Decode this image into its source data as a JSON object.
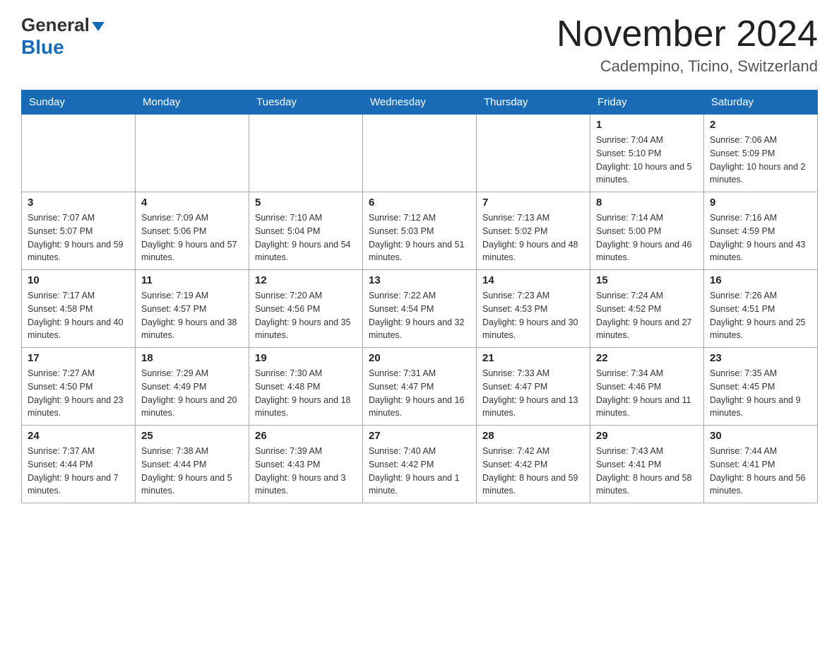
{
  "header": {
    "logo_general": "General",
    "logo_blue": "Blue",
    "month_title": "November 2024",
    "location": "Cadempino, Ticino, Switzerland"
  },
  "weekdays": [
    "Sunday",
    "Monday",
    "Tuesday",
    "Wednesday",
    "Thursday",
    "Friday",
    "Saturday"
  ],
  "weeks": [
    [
      {
        "day": "",
        "sunrise": "",
        "sunset": "",
        "daylight": ""
      },
      {
        "day": "",
        "sunrise": "",
        "sunset": "",
        "daylight": ""
      },
      {
        "day": "",
        "sunrise": "",
        "sunset": "",
        "daylight": ""
      },
      {
        "day": "",
        "sunrise": "",
        "sunset": "",
        "daylight": ""
      },
      {
        "day": "",
        "sunrise": "",
        "sunset": "",
        "daylight": ""
      },
      {
        "day": "1",
        "sunrise": "Sunrise: 7:04 AM",
        "sunset": "Sunset: 5:10 PM",
        "daylight": "Daylight: 10 hours and 5 minutes."
      },
      {
        "day": "2",
        "sunrise": "Sunrise: 7:06 AM",
        "sunset": "Sunset: 5:09 PM",
        "daylight": "Daylight: 10 hours and 2 minutes."
      }
    ],
    [
      {
        "day": "3",
        "sunrise": "Sunrise: 7:07 AM",
        "sunset": "Sunset: 5:07 PM",
        "daylight": "Daylight: 9 hours and 59 minutes."
      },
      {
        "day": "4",
        "sunrise": "Sunrise: 7:09 AM",
        "sunset": "Sunset: 5:06 PM",
        "daylight": "Daylight: 9 hours and 57 minutes."
      },
      {
        "day": "5",
        "sunrise": "Sunrise: 7:10 AM",
        "sunset": "Sunset: 5:04 PM",
        "daylight": "Daylight: 9 hours and 54 minutes."
      },
      {
        "day": "6",
        "sunrise": "Sunrise: 7:12 AM",
        "sunset": "Sunset: 5:03 PM",
        "daylight": "Daylight: 9 hours and 51 minutes."
      },
      {
        "day": "7",
        "sunrise": "Sunrise: 7:13 AM",
        "sunset": "Sunset: 5:02 PM",
        "daylight": "Daylight: 9 hours and 48 minutes."
      },
      {
        "day": "8",
        "sunrise": "Sunrise: 7:14 AM",
        "sunset": "Sunset: 5:00 PM",
        "daylight": "Daylight: 9 hours and 46 minutes."
      },
      {
        "day": "9",
        "sunrise": "Sunrise: 7:16 AM",
        "sunset": "Sunset: 4:59 PM",
        "daylight": "Daylight: 9 hours and 43 minutes."
      }
    ],
    [
      {
        "day": "10",
        "sunrise": "Sunrise: 7:17 AM",
        "sunset": "Sunset: 4:58 PM",
        "daylight": "Daylight: 9 hours and 40 minutes."
      },
      {
        "day": "11",
        "sunrise": "Sunrise: 7:19 AM",
        "sunset": "Sunset: 4:57 PM",
        "daylight": "Daylight: 9 hours and 38 minutes."
      },
      {
        "day": "12",
        "sunrise": "Sunrise: 7:20 AM",
        "sunset": "Sunset: 4:56 PM",
        "daylight": "Daylight: 9 hours and 35 minutes."
      },
      {
        "day": "13",
        "sunrise": "Sunrise: 7:22 AM",
        "sunset": "Sunset: 4:54 PM",
        "daylight": "Daylight: 9 hours and 32 minutes."
      },
      {
        "day": "14",
        "sunrise": "Sunrise: 7:23 AM",
        "sunset": "Sunset: 4:53 PM",
        "daylight": "Daylight: 9 hours and 30 minutes."
      },
      {
        "day": "15",
        "sunrise": "Sunrise: 7:24 AM",
        "sunset": "Sunset: 4:52 PM",
        "daylight": "Daylight: 9 hours and 27 minutes."
      },
      {
        "day": "16",
        "sunrise": "Sunrise: 7:26 AM",
        "sunset": "Sunset: 4:51 PM",
        "daylight": "Daylight: 9 hours and 25 minutes."
      }
    ],
    [
      {
        "day": "17",
        "sunrise": "Sunrise: 7:27 AM",
        "sunset": "Sunset: 4:50 PM",
        "daylight": "Daylight: 9 hours and 23 minutes."
      },
      {
        "day": "18",
        "sunrise": "Sunrise: 7:29 AM",
        "sunset": "Sunset: 4:49 PM",
        "daylight": "Daylight: 9 hours and 20 minutes."
      },
      {
        "day": "19",
        "sunrise": "Sunrise: 7:30 AM",
        "sunset": "Sunset: 4:48 PM",
        "daylight": "Daylight: 9 hours and 18 minutes."
      },
      {
        "day": "20",
        "sunrise": "Sunrise: 7:31 AM",
        "sunset": "Sunset: 4:47 PM",
        "daylight": "Daylight: 9 hours and 16 minutes."
      },
      {
        "day": "21",
        "sunrise": "Sunrise: 7:33 AM",
        "sunset": "Sunset: 4:47 PM",
        "daylight": "Daylight: 9 hours and 13 minutes."
      },
      {
        "day": "22",
        "sunrise": "Sunrise: 7:34 AM",
        "sunset": "Sunset: 4:46 PM",
        "daylight": "Daylight: 9 hours and 11 minutes."
      },
      {
        "day": "23",
        "sunrise": "Sunrise: 7:35 AM",
        "sunset": "Sunset: 4:45 PM",
        "daylight": "Daylight: 9 hours and 9 minutes."
      }
    ],
    [
      {
        "day": "24",
        "sunrise": "Sunrise: 7:37 AM",
        "sunset": "Sunset: 4:44 PM",
        "daylight": "Daylight: 9 hours and 7 minutes."
      },
      {
        "day": "25",
        "sunrise": "Sunrise: 7:38 AM",
        "sunset": "Sunset: 4:44 PM",
        "daylight": "Daylight: 9 hours and 5 minutes."
      },
      {
        "day": "26",
        "sunrise": "Sunrise: 7:39 AM",
        "sunset": "Sunset: 4:43 PM",
        "daylight": "Daylight: 9 hours and 3 minutes."
      },
      {
        "day": "27",
        "sunrise": "Sunrise: 7:40 AM",
        "sunset": "Sunset: 4:42 PM",
        "daylight": "Daylight: 9 hours and 1 minute."
      },
      {
        "day": "28",
        "sunrise": "Sunrise: 7:42 AM",
        "sunset": "Sunset: 4:42 PM",
        "daylight": "Daylight: 8 hours and 59 minutes."
      },
      {
        "day": "29",
        "sunrise": "Sunrise: 7:43 AM",
        "sunset": "Sunset: 4:41 PM",
        "daylight": "Daylight: 8 hours and 58 minutes."
      },
      {
        "day": "30",
        "sunrise": "Sunrise: 7:44 AM",
        "sunset": "Sunset: 4:41 PM",
        "daylight": "Daylight: 8 hours and 56 minutes."
      }
    ]
  ]
}
